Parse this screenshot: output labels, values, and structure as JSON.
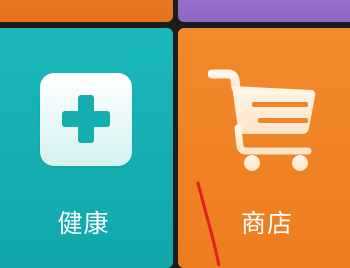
{
  "tiles": {
    "health": {
      "label": "健康",
      "icon": "plus-icon",
      "color": "#15b0b2"
    },
    "store": {
      "label": "商店",
      "icon": "shopping-cart-icon",
      "color": "#f08426"
    },
    "top_left": {
      "color": "#e67720"
    },
    "top_right": {
      "color": "#9169c8"
    }
  },
  "annotation": {
    "color": "#e02020"
  }
}
